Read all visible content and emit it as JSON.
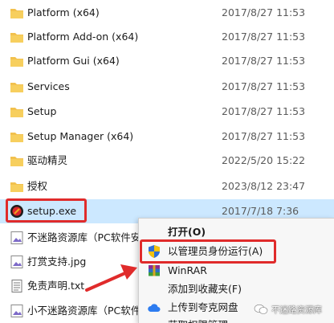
{
  "files": [
    {
      "name": "Platform (x64)",
      "date": "2017/8/27 11:53",
      "icon": "folder-icon"
    },
    {
      "name": "Platform Add-on (x64)",
      "date": "2017/8/27 11:53",
      "icon": "folder-icon"
    },
    {
      "name": "Platform Gui (x64)",
      "date": "2017/8/27 11:53",
      "icon": "folder-icon"
    },
    {
      "name": "Services",
      "date": "2017/8/27 11:53",
      "icon": "folder-icon"
    },
    {
      "name": "Setup",
      "date": "2017/8/27 11:53",
      "icon": "folder-icon"
    },
    {
      "name": "Setup Manager (x64)",
      "date": "2017/8/27 11:53",
      "icon": "folder-icon"
    },
    {
      "name": "驱动精灵",
      "date": "2022/5/20 15:22",
      "icon": "folder-icon"
    },
    {
      "name": "授权",
      "date": "2023/8/12 23:47",
      "icon": "folder-icon"
    },
    {
      "name": "setup.exe",
      "date": "2017/7/18 7:36",
      "icon": "installer-icon",
      "selected": true
    },
    {
      "name": "不迷路资源库（PC软件安装",
      "date": "",
      "icon": "image-file-icon"
    },
    {
      "name": "打赏支持.jpg",
      "date": "",
      "icon": "image-file-icon"
    },
    {
      "name": "免责声明.txt",
      "date": "",
      "icon": "text-file-icon"
    },
    {
      "name": "小不迷路资源库（PC软件安",
      "date": "",
      "icon": "image-file-icon"
    }
  ],
  "context_menu": {
    "items": [
      {
        "label": "打开(O)",
        "icon": "",
        "bold": true
      },
      {
        "label": "以管理员身份运行(A)",
        "icon": "uac-shield-icon"
      },
      {
        "label": "WinRAR",
        "icon": "winrar-icon"
      },
      {
        "label": "添加到收藏夹(F)",
        "icon": ""
      },
      {
        "label": "上传到夸克网盘",
        "icon": "cloud-upload-icon"
      },
      {
        "label": "获取权限管理",
        "icon": ""
      }
    ]
  },
  "watermark": {
    "text": "不迷路资源库",
    "icon": "wechat-icon"
  },
  "colors": {
    "highlight": "#e02b2b",
    "selected_row": "#cce8ff",
    "folder": "#f2c14e"
  }
}
